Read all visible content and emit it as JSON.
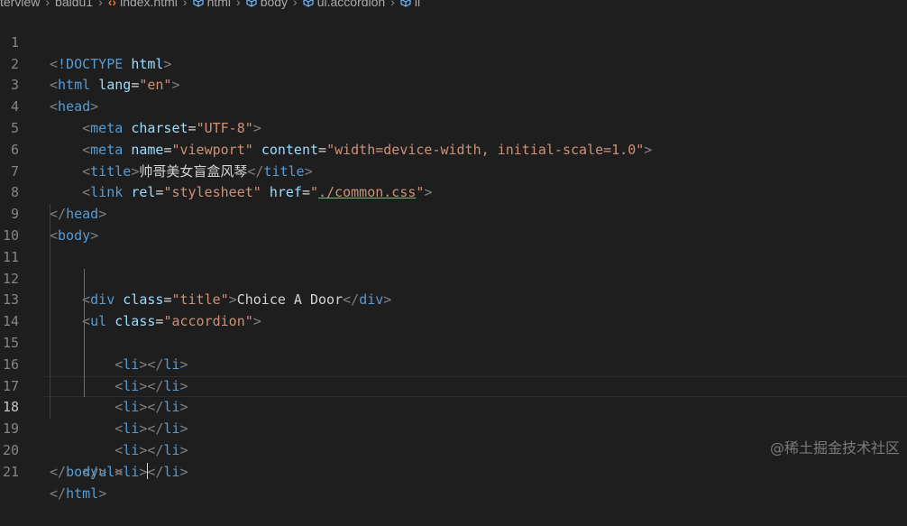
{
  "breadcrumb": {
    "items": [
      "terview",
      "baidu1",
      "index.html",
      "html",
      "body",
      "ul.accordion",
      "li"
    ]
  },
  "editor": {
    "active_line": 18,
    "line_numbers": [
      "1",
      "2",
      "3",
      "4",
      "5",
      "6",
      "7",
      "8",
      "9",
      "10",
      "11",
      "12",
      "13",
      "14",
      "15",
      "16",
      "17",
      "18",
      "19",
      "20",
      "21"
    ],
    "html_tag_name": "html",
    "lang_attr": "lang",
    "lang_value": "\"en\"",
    "head_tag": "head",
    "meta_tag": "meta",
    "charset_attr": "charset",
    "charset_value": "\"UTF-8\"",
    "name_attr": "name",
    "viewport_value": "\"viewport\"",
    "content_attr": "content",
    "content_value": "\"width=device-width, initial-scale=1.0\"",
    "title_tag": "title",
    "title_text": "帅哥美女盲盒风琴",
    "link_tag": "link",
    "rel_attr": "rel",
    "rel_value": "\"stylesheet\"",
    "href_attr": "href",
    "href_quote": "\"",
    "href_path": "./common.css",
    "body_tag": "body",
    "div_tag": "div",
    "class_attr": "class",
    "title_class_value": "\"title\"",
    "div_text": "Choice A Door",
    "ul_tag": "ul",
    "accordion_value": "\"accordion\"",
    "li_tag": "li",
    "doctype": "!DOCTYPE",
    "doctype_html": "html"
  },
  "watermark": "@稀土掘金技术社区"
}
